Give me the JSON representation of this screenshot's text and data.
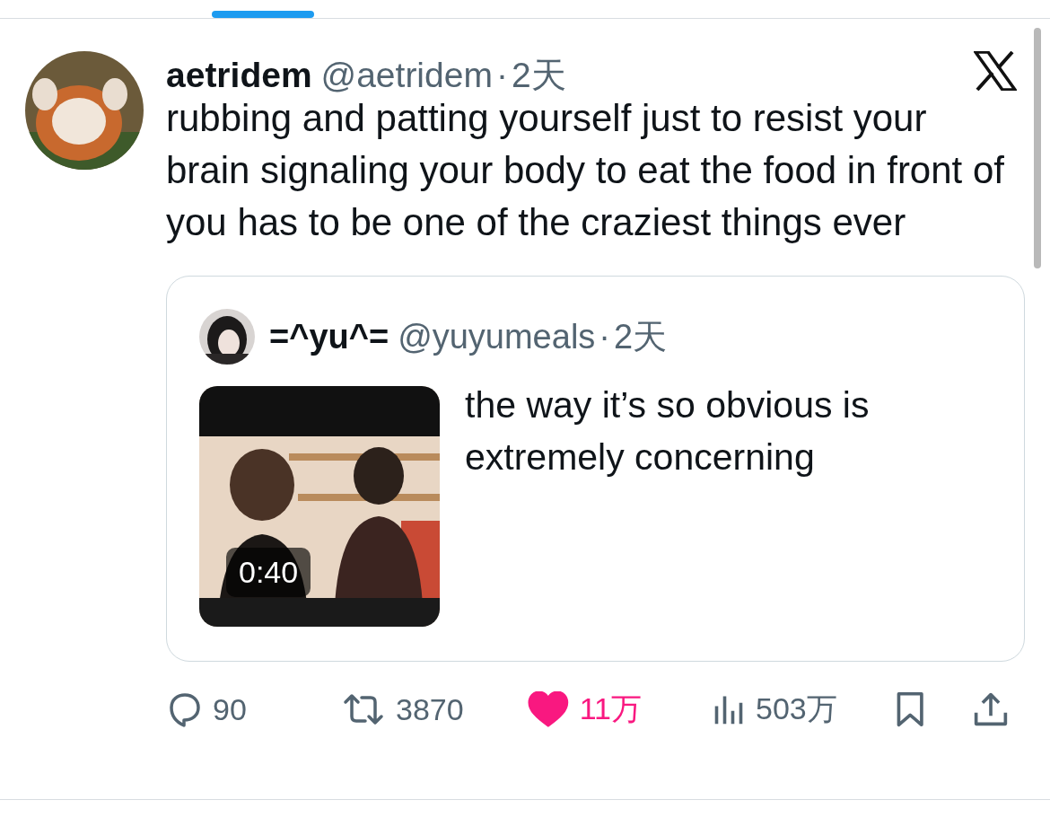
{
  "tabs": [
    {
      "selected": true
    }
  ],
  "tweet": {
    "author": {
      "name": "aetridem",
      "handle": "@aetridem",
      "separator": "·",
      "time": "2天"
    },
    "text": "rubbing and patting yourself just to resist your brain signaling your body to eat the food in front of you has to be one of the craziest things ever",
    "quote": {
      "name": "=^yu^=",
      "handle": "@yuyumeals",
      "separator": "·",
      "time": "2天",
      "text": "the way it’s so obvious is extremely concerning",
      "media": {
        "kind": "picture",
        "duration": "0:40"
      }
    },
    "actions": [
      {
        "kind": "reply",
        "count": "90",
        "selected": false
      },
      {
        "kind": "repost",
        "count": "3870",
        "selected": false
      },
      {
        "kind": "like",
        "count": "11万",
        "selected": true
      },
      {
        "kind": "views",
        "count": "503万",
        "selected": false
      },
      {
        "kind": "bookmark",
        "selected": false
      },
      {
        "kind": "share",
        "selected": false
      }
    ]
  }
}
